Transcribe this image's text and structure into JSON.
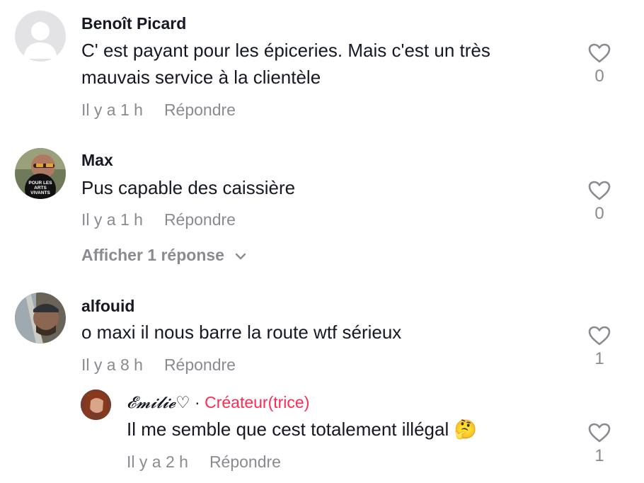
{
  "comments": [
    {
      "username": "Benoît Picard",
      "text": "C' est payant pour les épiceries. Mais c'est un très mauvais service à la clientèle",
      "time": "Il y a 1 h",
      "reply_label": "Répondre",
      "likes": "0",
      "avatar_icon": "default-user-icon"
    },
    {
      "username": "Max",
      "text": "Pus capable des caissière",
      "time": "Il y a 1 h",
      "reply_label": "Répondre",
      "likes": "0",
      "avatar_badge_text": "POUR LES ARTS VIVANTS",
      "view_replies": "Afficher 1 réponse"
    },
    {
      "username": "alfouid",
      "text": "o maxi il nous barre la route wtf sérieux",
      "time": "Il y a 8 h",
      "reply_label": "Répondre",
      "likes": "1"
    }
  ],
  "reply": {
    "username": "𝓔𝓶𝓲𝓵𝓲𝓮♡",
    "separator": "·",
    "creator_badge": "Créateur(trice)",
    "text": "Il me semble que cest totalement illégal 🤔",
    "time": "Il y a 2 h",
    "reply_label": "Répondre",
    "likes": "1"
  },
  "colors": {
    "accent": "#fe2c55",
    "secondary_text": "#8a8b91",
    "primary_text": "#161823"
  }
}
